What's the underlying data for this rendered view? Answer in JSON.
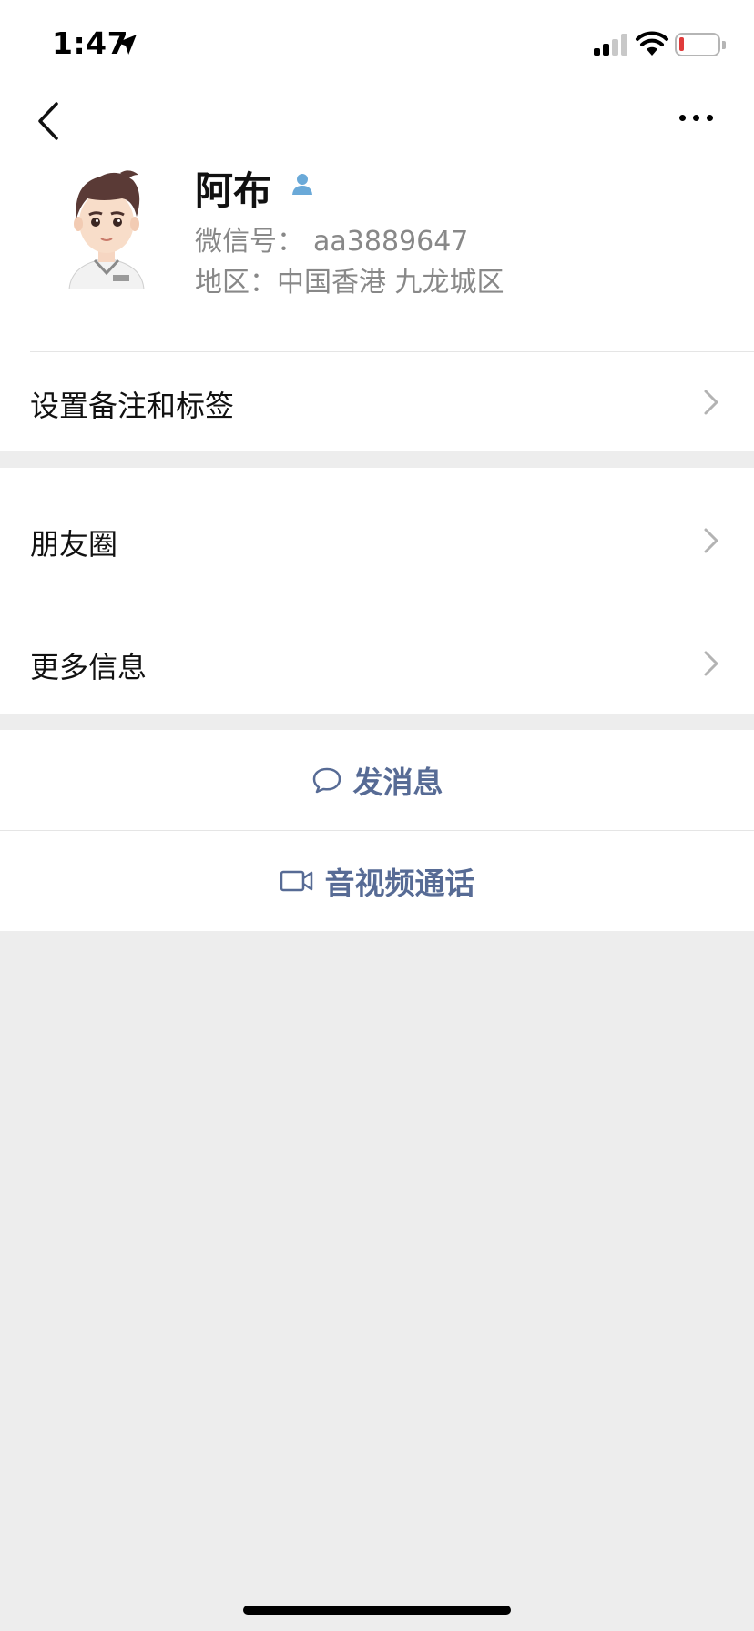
{
  "status_bar": {
    "time": "1:47",
    "colors": {
      "battery_level": "#e03b3b"
    }
  },
  "nav": {
    "back_icon": "chevron-left-icon",
    "more_icon": "ellipsis-icon"
  },
  "profile": {
    "name": "阿布",
    "wechat_id_label": "微信号：",
    "wechat_id": "aa3889647",
    "region_label": "地区：",
    "region": "中国香港 九龙城区",
    "badge_color": "#6aa9d8"
  },
  "rows": {
    "remark_tags": "设置备注和标签",
    "moments": "朋友圈",
    "more_info": "更多信息"
  },
  "actions": {
    "send_message": "发消息",
    "video_call": "音视频通话",
    "link_color": "#576b95"
  }
}
